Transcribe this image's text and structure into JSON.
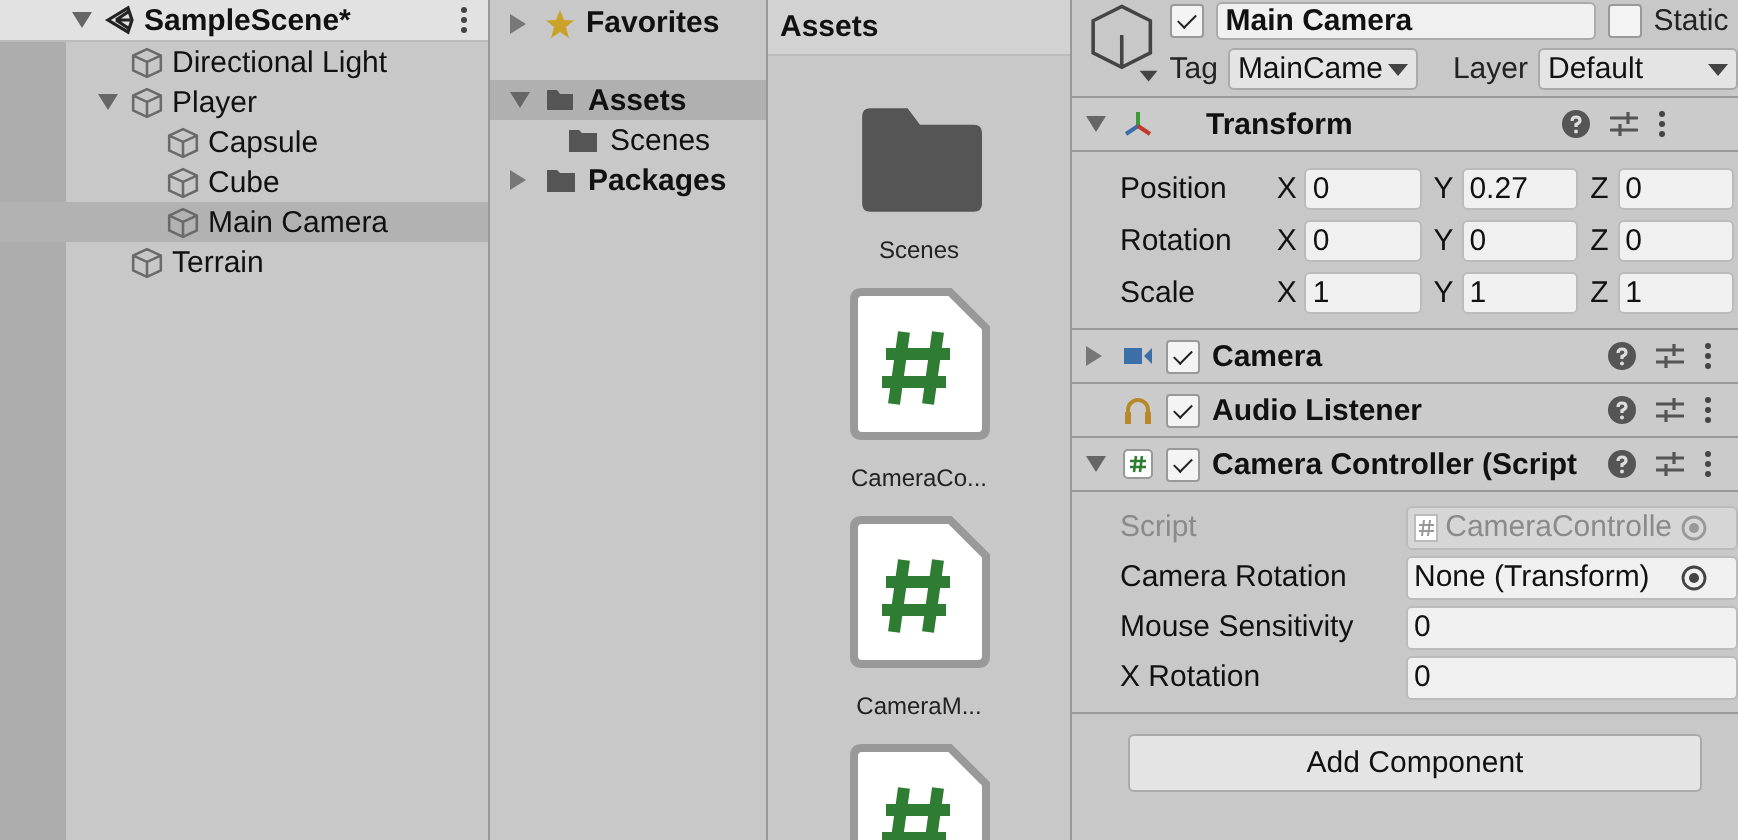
{
  "hierarchy": {
    "scene": "SampleScene*",
    "expanded": true,
    "items": [
      {
        "label": "Directional Light",
        "selected": false
      },
      {
        "label": "Player",
        "selected": false,
        "expanded": true,
        "children": [
          {
            "label": "Capsule",
            "selected": false
          },
          {
            "label": "Cube",
            "selected": false
          },
          {
            "label": "Main Camera",
            "selected": true
          }
        ]
      },
      {
        "label": "Terrain",
        "selected": false
      }
    ]
  },
  "project": {
    "favorites": {
      "label": "Favorites",
      "expanded": false
    },
    "folders": [
      {
        "label": "Assets",
        "selected": true,
        "expanded": true,
        "children": [
          {
            "label": "Scenes",
            "selected": false
          }
        ]
      },
      {
        "label": "Packages",
        "selected": false,
        "expanded": false
      }
    ],
    "grid_title": "Assets",
    "grid_items": [
      {
        "kind": "folder",
        "label": "Scenes"
      },
      {
        "kind": "script",
        "label": "CameraCo..."
      },
      {
        "kind": "script",
        "label": "CameraM..."
      },
      {
        "kind": "script"
      }
    ]
  },
  "inspector": {
    "active": true,
    "name": "Main Camera",
    "static": {
      "label": "Static",
      "checked": false
    },
    "tag": {
      "label": "Tag",
      "value": "MainCame"
    },
    "layer": {
      "label": "Layer",
      "value": "Default"
    },
    "components": [
      {
        "kind": "transform",
        "title": "Transform",
        "expanded": true
      },
      {
        "kind": "camera",
        "title": "Camera",
        "expanded": false,
        "enabled": true
      },
      {
        "kind": "audio",
        "title": "Audio Listener",
        "enabled": true
      },
      {
        "kind": "script",
        "title": "Camera Controller (Script",
        "expanded": true,
        "enabled": true
      }
    ],
    "transform": [
      {
        "label": "Position",
        "axes": [
          {
            "axis": "X",
            "value": "0"
          },
          {
            "axis": "Y",
            "value": "0.27"
          },
          {
            "axis": "Z",
            "value": "0"
          }
        ]
      },
      {
        "label": "Rotation",
        "axes": [
          {
            "axis": "X",
            "value": "0"
          },
          {
            "axis": "Y",
            "value": "0"
          },
          {
            "axis": "Z",
            "value": "0"
          }
        ]
      },
      {
        "label": "Scale",
        "axes": [
          {
            "axis": "X",
            "value": "1"
          },
          {
            "axis": "Y",
            "value": "1"
          },
          {
            "axis": "Z",
            "value": "1"
          }
        ]
      }
    ],
    "script_fields": [
      {
        "kind": "script",
        "label": "Script",
        "value": "CameraControlle",
        "disabled": true
      },
      {
        "kind": "object",
        "label": "Camera Rotation",
        "value": "None (Transform)",
        "disabled": false
      },
      {
        "kind": "number",
        "label": "Mouse Sensitivity",
        "value": "0",
        "disabled": false
      },
      {
        "kind": "number",
        "label": "X Rotation",
        "value": "0",
        "disabled": false
      }
    ],
    "add_button": "Add Component"
  }
}
